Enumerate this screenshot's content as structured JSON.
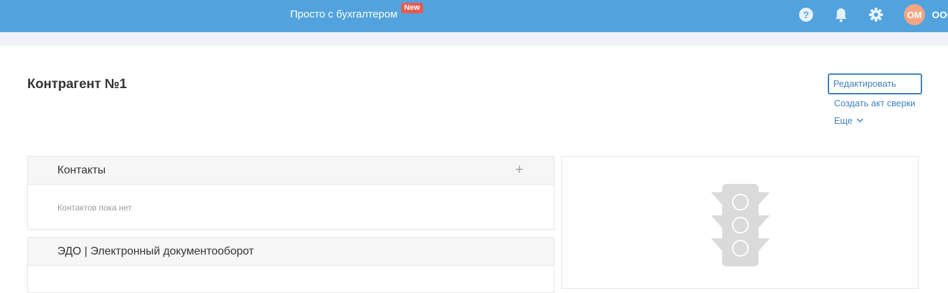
{
  "header": {
    "promo_label": "Просто с бухгалтером",
    "promo_badge": "New",
    "avatar_initials": "ОМ",
    "org_name": "ООО",
    "icons": [
      "help-icon",
      "bell-icon",
      "gear-icon"
    ],
    "accent_color": "#52a3dd"
  },
  "page": {
    "title": "Контрагент №1"
  },
  "actions": {
    "edit_label": "Редактировать",
    "reconciliation_label": "Создать акт сверки",
    "more_label": "Еще"
  },
  "contacts": {
    "title": "Контакты",
    "empty_text": "Контактов пока нет"
  },
  "edo": {
    "title": "ЭДО | Электронный документооборот"
  },
  "status_card": {
    "icon": "traffic-light-icon"
  }
}
